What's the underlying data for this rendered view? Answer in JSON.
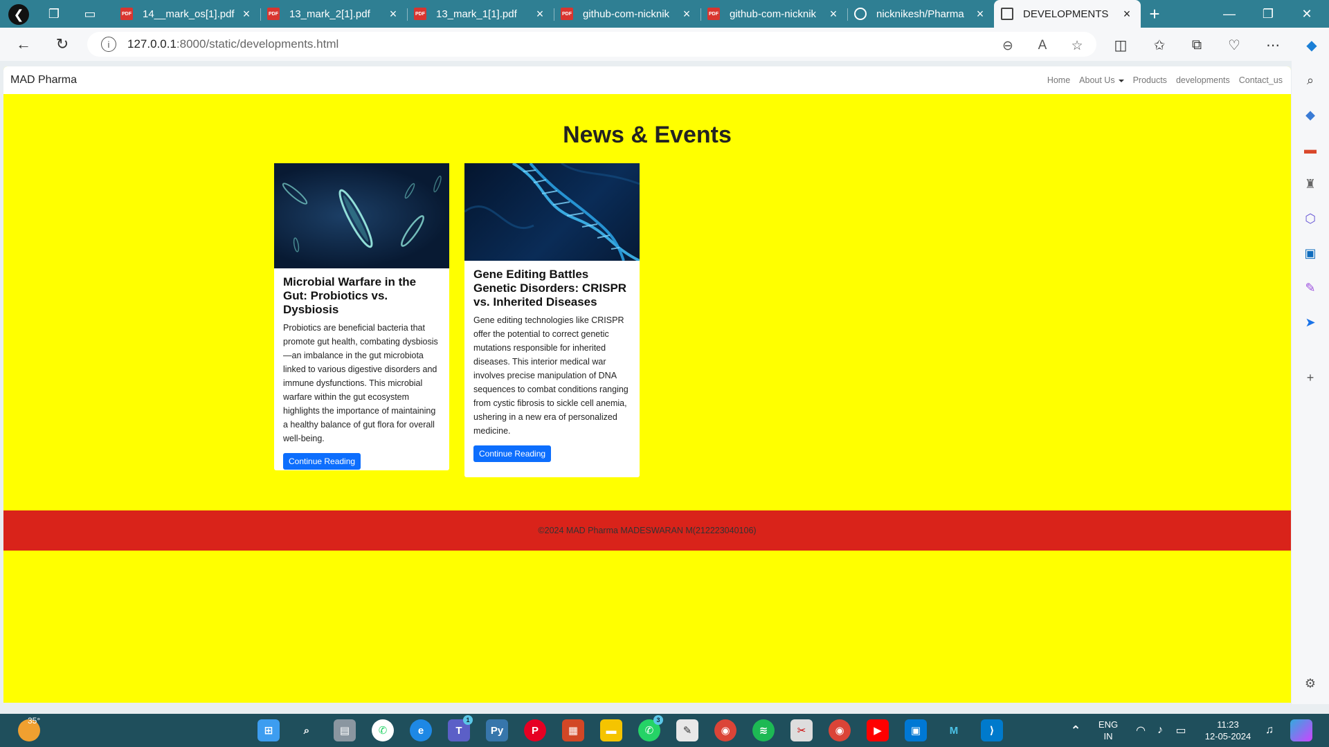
{
  "browser": {
    "tabs": [
      {
        "label": "14__mark_os[1].pdf",
        "icon": "pdf-icon"
      },
      {
        "label": "13_mark_2[1].pdf",
        "icon": "pdf-icon"
      },
      {
        "label": "13_mark_1[1].pdf",
        "icon": "pdf-icon"
      },
      {
        "label": "github-com-nicknik",
        "icon": "pdf-icon"
      },
      {
        "label": "github-com-nicknik",
        "icon": "pdf-icon"
      },
      {
        "label": "nicknikesh/Pharma",
        "icon": "github-icon"
      },
      {
        "label": "DEVELOPMENTS",
        "icon": "document-icon"
      }
    ],
    "url_host": "127.0.0.1",
    "url_rest": ":8000/static/developments.html"
  },
  "site": {
    "brand": "MAD Pharma",
    "nav": {
      "home": "Home",
      "about": "About Us",
      "products": "Products",
      "developments": "developments",
      "contact": "Contact_us"
    },
    "heading": "News & Events",
    "cards": [
      {
        "title": "Microbial Warfare in the Gut: Probiotics vs. Dysbiosis",
        "text": "Probiotics are beneficial bacteria that promote gut health, combating dysbiosis—an imbalance in the gut microbiota linked to various digestive disorders and immune dysfunctions. This microbial warfare within the gut ecosystem highlights the importance of maintaining a healthy balance of gut flora for overall well-being.",
        "button": "Continue Reading"
      },
      {
        "title": "Gene Editing Battles Genetic Disorders: CRISPR vs. Inherited Diseases",
        "text": "Gene editing technologies like CRISPR offer the potential to correct genetic mutations responsible for inherited diseases. This interior medical war involves precise manipulation of DNA sequences to combat conditions ranging from cystic fibrosis to sickle cell anemia, ushering in a new era of personalized medicine.",
        "button": "Continue Reading"
      }
    ],
    "footer": "©2024 MAD Pharma MADESWARAN M(212223040106)"
  },
  "taskbar": {
    "weather": "35°",
    "lang_line1": "ENG",
    "lang_line2": "IN",
    "time": "11:23",
    "date": "12-05-2024",
    "badges": {
      "teams": "1",
      "whatsapp": "3"
    }
  },
  "colors": {
    "page_bg": "#ffff00",
    "footer_bg": "#d9231a",
    "button": "#0d6efd",
    "titlebar": "#2f7f93"
  }
}
